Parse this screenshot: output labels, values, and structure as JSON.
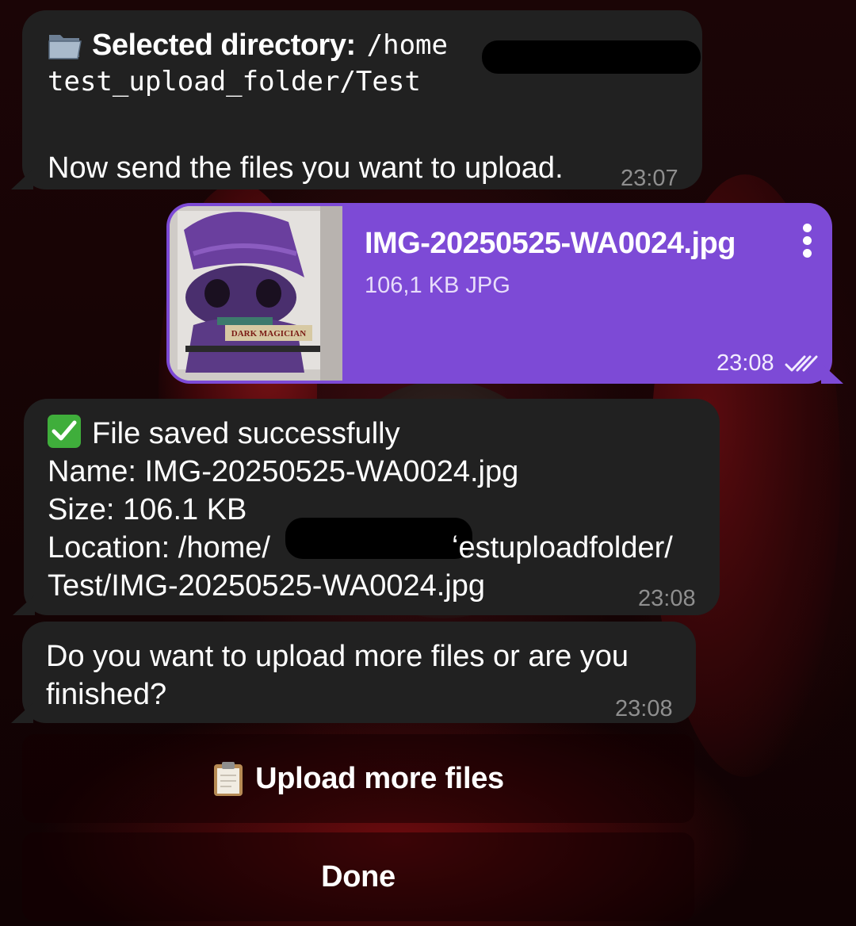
{
  "chat": {
    "messages": [
      {
        "label": "Selected directory:",
        "path_start": "/home",
        "path_end": "test_upload_folder/Test",
        "instruction": "Now send the files you want to upload.",
        "time": "23:07"
      },
      {
        "file_name": "IMG-20250525-WA0024.jpg",
        "file_meta": "106,1 KB JPG",
        "thumbnail_caption": "DARK MAGICIAN",
        "time": "23:08"
      },
      {
        "status": "File saved successfully",
        "name_line": "Name: IMG-20250525-WA0024.jpg",
        "size_line": "Size: 106.1 KB",
        "location_prefix": "Location: /home/",
        "location_partial": "ʻestuploadfolder/",
        "location_line2": "Test/IMG-20250525-WA0024.jpg",
        "time": "23:08"
      },
      {
        "question": "Do you want to upload more files or are you finished?",
        "time": "23:08"
      }
    ]
  },
  "keyboard": {
    "upload_label": "Upload more files",
    "done_label": "Done"
  },
  "icons": {
    "folder": "folder-icon",
    "check": "check-mark-icon",
    "clipboard": "clipboard-icon",
    "more": "more-vertical-icon",
    "ticks": "double-check-icon"
  },
  "colors": {
    "bubble_incoming": "#212121",
    "bubble_outgoing": "#7d4ad6",
    "check_green": "#3fae3b"
  }
}
